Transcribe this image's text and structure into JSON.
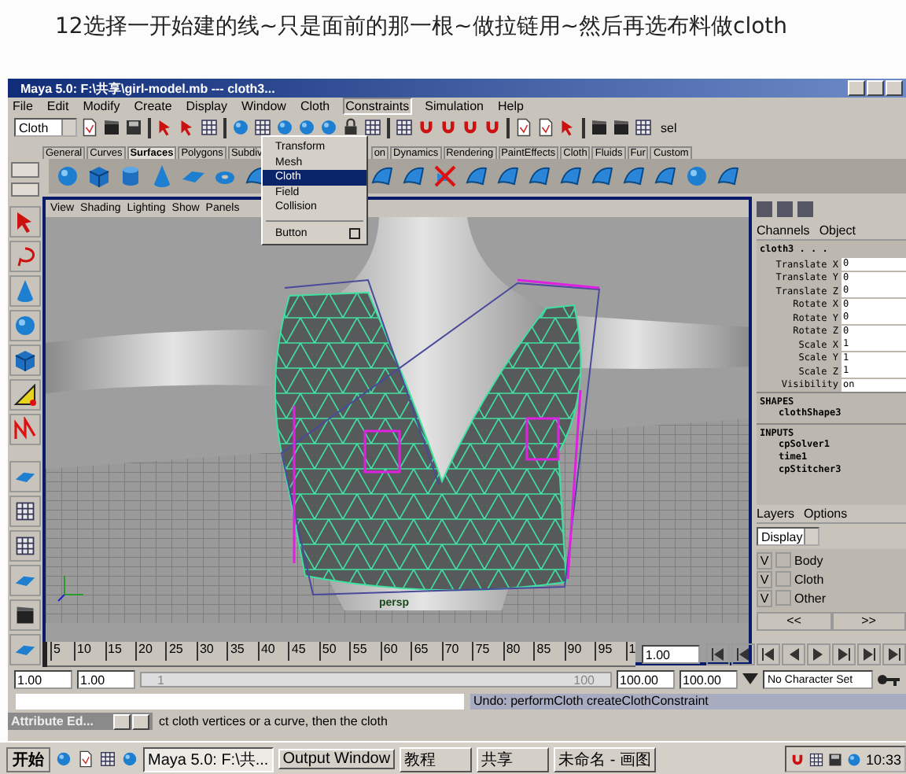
{
  "caption": "12选择一开始建的线~只是面前的那一根~做拉链用~然后再选布料做cloth",
  "window": {
    "title": "Maya 5.0: F:\\共享\\girl-model.mb  ---  cloth3..."
  },
  "menu_bar": [
    {
      "label": "File",
      "selected": false
    },
    {
      "label": "Edit",
      "selected": false
    },
    {
      "label": "Modify",
      "selected": false
    },
    {
      "label": "Create",
      "selected": false
    },
    {
      "label": "Display",
      "selected": false
    },
    {
      "label": "Window",
      "selected": false
    },
    {
      "label": "Cloth",
      "selected": false
    },
    {
      "label": "Constraints",
      "selected": true
    },
    {
      "label": "Simulation",
      "selected": false
    },
    {
      "label": "Help",
      "selected": false
    }
  ],
  "dropdown_menu": [
    {
      "label": "Transform",
      "selected": false,
      "option_box": false
    },
    {
      "label": "Mesh",
      "selected": false,
      "option_box": false
    },
    {
      "label": "Cloth",
      "selected": true,
      "option_box": false
    },
    {
      "label": "Field",
      "selected": false,
      "option_box": false
    },
    {
      "label": "Collision",
      "selected": false,
      "option_box": false
    },
    {
      "label": "Button",
      "selected": false,
      "option_box": true
    }
  ],
  "status_line": {
    "menu_set": "Cloth",
    "select_label": "sel"
  },
  "shelf_tabs": [
    {
      "label": "General",
      "selected": false
    },
    {
      "label": "Curves",
      "selected": false
    },
    {
      "label": "Surfaces",
      "selected": true
    },
    {
      "label": "Polygons",
      "selected": false
    },
    {
      "label": "Subdiv",
      "selected": false
    },
    {
      "label": "on",
      "selected": false
    },
    {
      "label": "Dynamics",
      "selected": false
    },
    {
      "label": "Rendering",
      "selected": false
    },
    {
      "label": "PaintEffects",
      "selected": false
    },
    {
      "label": "Cloth",
      "selected": false
    },
    {
      "label": "Fluids",
      "selected": false
    },
    {
      "label": "Fur",
      "selected": false
    },
    {
      "label": "Custom",
      "selected": false
    }
  ],
  "viewport": {
    "menu": [
      "View",
      "Shading",
      "Lighting",
      "Show",
      "Panels"
    ],
    "camera": "persp"
  },
  "channel_box": {
    "tabs": [
      "Channels",
      "Object"
    ],
    "object": "cloth3 . . .",
    "channels": [
      {
        "name": "Translate X",
        "value": "0"
      },
      {
        "name": "Translate Y",
        "value": "0"
      },
      {
        "name": "Translate Z",
        "value": "0"
      },
      {
        "name": "Rotate X",
        "value": "0"
      },
      {
        "name": "Rotate Y",
        "value": "0"
      },
      {
        "name": "Rotate Z",
        "value": "0"
      },
      {
        "name": "Scale X",
        "value": "1"
      },
      {
        "name": "Scale Y",
        "value": "1"
      },
      {
        "name": "Scale Z",
        "value": "1"
      },
      {
        "name": "Visibility",
        "value": "on"
      }
    ],
    "shapes_heading": "SHAPES",
    "shapes": [
      "clothShape3"
    ],
    "inputs_heading": "INPUTS",
    "inputs": [
      "cpSolver1",
      "time1",
      "cpStitcher3"
    ]
  },
  "layer_editor": {
    "menu": [
      "Layers",
      "Options"
    ],
    "display": "Display",
    "layers": [
      {
        "visibility": "V",
        "name": "Body"
      },
      {
        "visibility": "V",
        "name": "Cloth"
      },
      {
        "visibility": "V",
        "name": "Other"
      }
    ],
    "nav": [
      "<<",
      ">>"
    ]
  },
  "time_slider": {
    "ticks": [
      "5",
      "10",
      "15",
      "20",
      "25",
      "30",
      "35",
      "40",
      "45",
      "50",
      "55",
      "60",
      "65",
      "70",
      "75",
      "80",
      "85",
      "90",
      "95",
      "1"
    ],
    "current_time": "1.00",
    "level": 0
  },
  "range_slider": {
    "start": "1.00",
    "playback_start": "1.00",
    "range_start": "1",
    "range_end": "100",
    "level": 1,
    "playback_end": "100.00",
    "end": "100.00",
    "character_set": "No Character Set"
  },
  "command_line": {
    "response": "Undo: performCloth createClothConstraint"
  },
  "help_line": "ct cloth vertices or a curve, then the cloth",
  "minimized_window": {
    "title": "Attribute Ed..."
  },
  "taskbar": {
    "start": "开始",
    "tasks": [
      {
        "label": "Maya 5.0: F:\\共...",
        "selected": true
      },
      {
        "label": "Output Window",
        "selected": false
      },
      {
        "label": "教程",
        "selected": false
      },
      {
        "label": "共享",
        "selected": false
      },
      {
        "label": "未命名 - 画图",
        "selected": false
      }
    ],
    "clock": "10:33"
  }
}
